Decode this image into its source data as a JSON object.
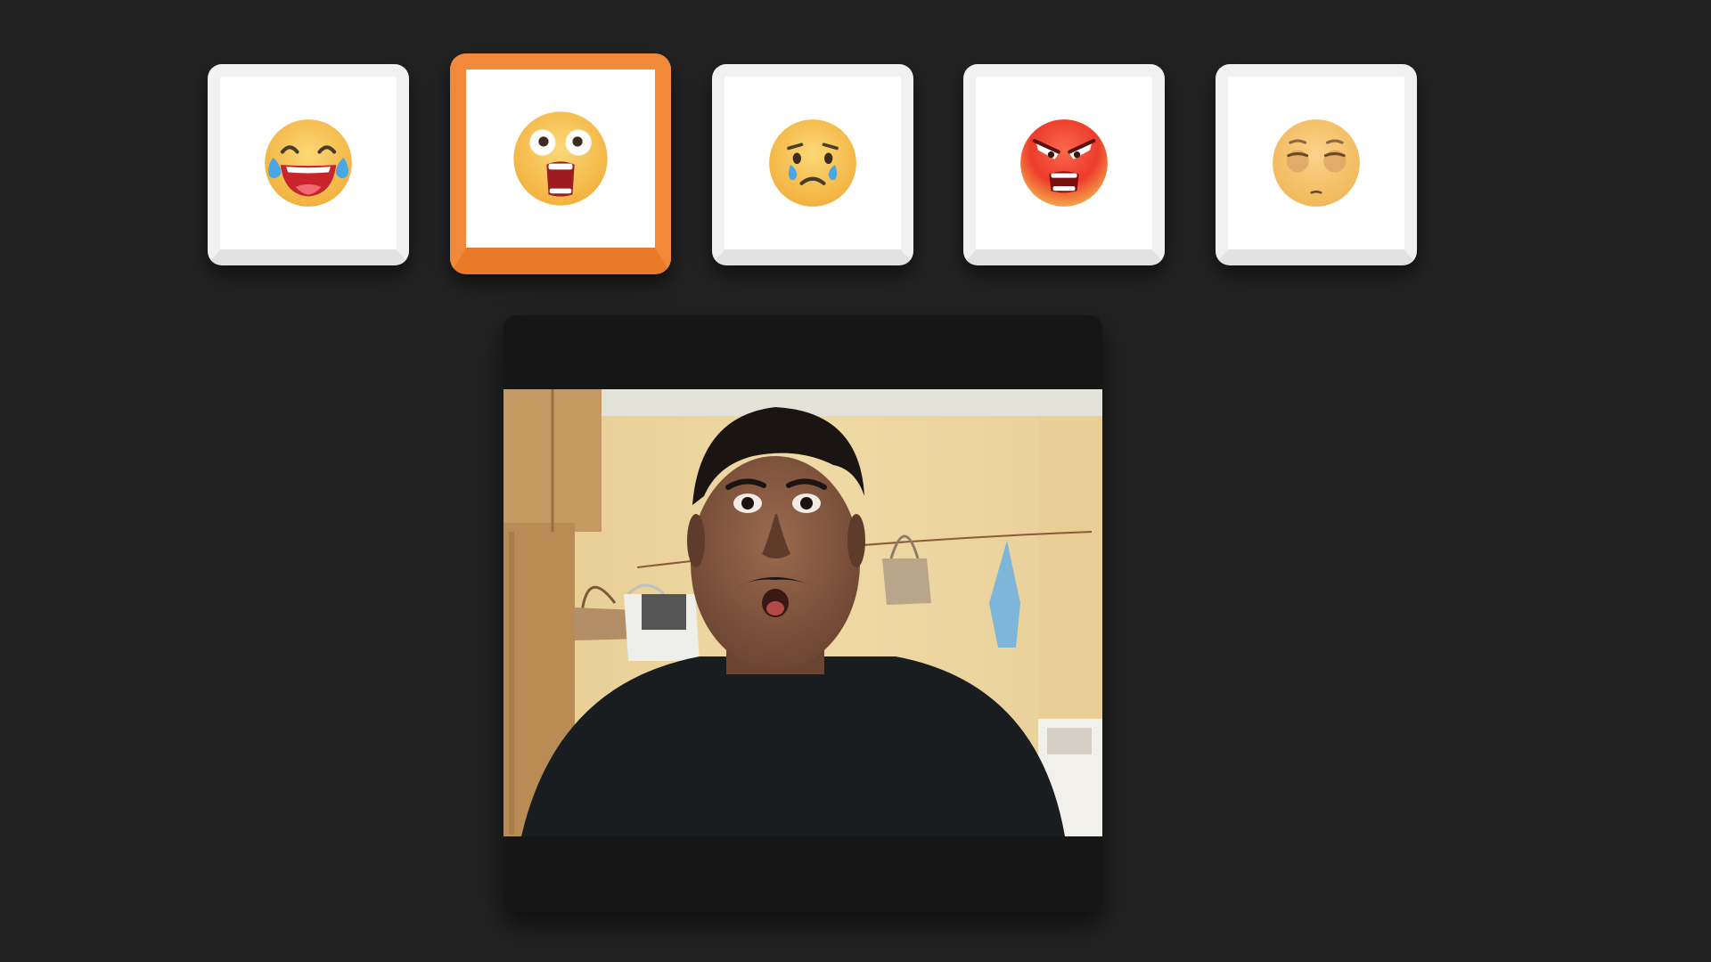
{
  "emoji_picker": {
    "options": [
      {
        "emotion": "laughing",
        "icon": "tears-of-joy-face-icon",
        "selected": false
      },
      {
        "emotion": "surprised",
        "icon": "screaming-face-icon",
        "selected": true
      },
      {
        "emotion": "sad",
        "icon": "crying-face-icon",
        "selected": false
      },
      {
        "emotion": "angry",
        "icon": "angry-face-icon",
        "selected": false
      },
      {
        "emotion": "neutral",
        "icon": "relieved-face-icon",
        "selected": false
      }
    ],
    "accent_color": "#f0893a"
  },
  "webcam": {
    "icon": "webcam-video-feed",
    "background": "#161616"
  },
  "colors": {
    "page_background": "#222222",
    "card_background": "#ffffff",
    "emoji_yellow": "#f7c15a",
    "emoji_red": "#ee3b2b"
  }
}
